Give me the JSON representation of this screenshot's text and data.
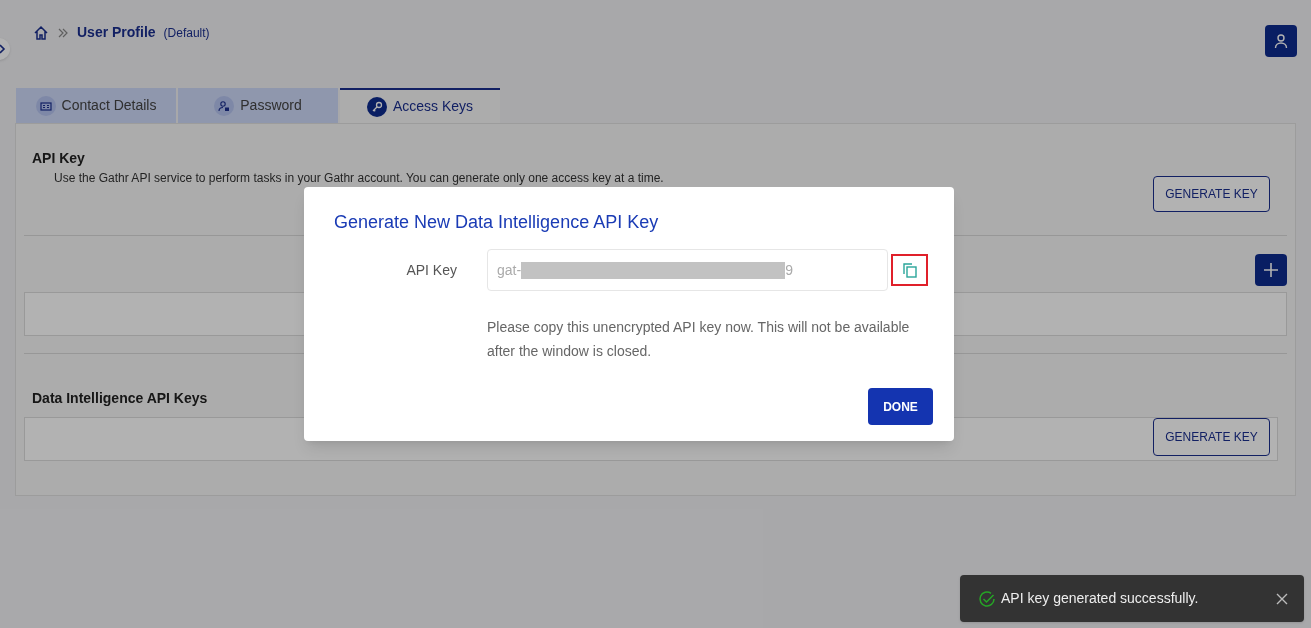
{
  "breadcrumb": {
    "title": "User Profile",
    "subtitle": "(Default)"
  },
  "tabs": [
    {
      "label": "Contact Details",
      "kind": "contact",
      "selected": false
    },
    {
      "label": "Password",
      "kind": "password",
      "selected": false
    },
    {
      "label": "Access Keys",
      "kind": "key",
      "selected": true
    }
  ],
  "api_key_section": {
    "heading": "API Key",
    "description": "Use the Gathr API service to perform tasks in your Gathr account. You can generate only one access key at a time.",
    "button": "GENERATE KEY"
  },
  "keys_section": {
    "heading": "Data Intelligence API Keys",
    "button": "GENERATE KEY"
  },
  "modal": {
    "title": "Generate New Data Intelligence API Key",
    "field_label": "API Key",
    "key_prefix": "gat-",
    "key_suffix": "9",
    "note": "Please copy this unencrypted API key now. This will not be available after the window is closed.",
    "button": "DONE"
  },
  "toast": {
    "message": "API key generated successfully."
  }
}
